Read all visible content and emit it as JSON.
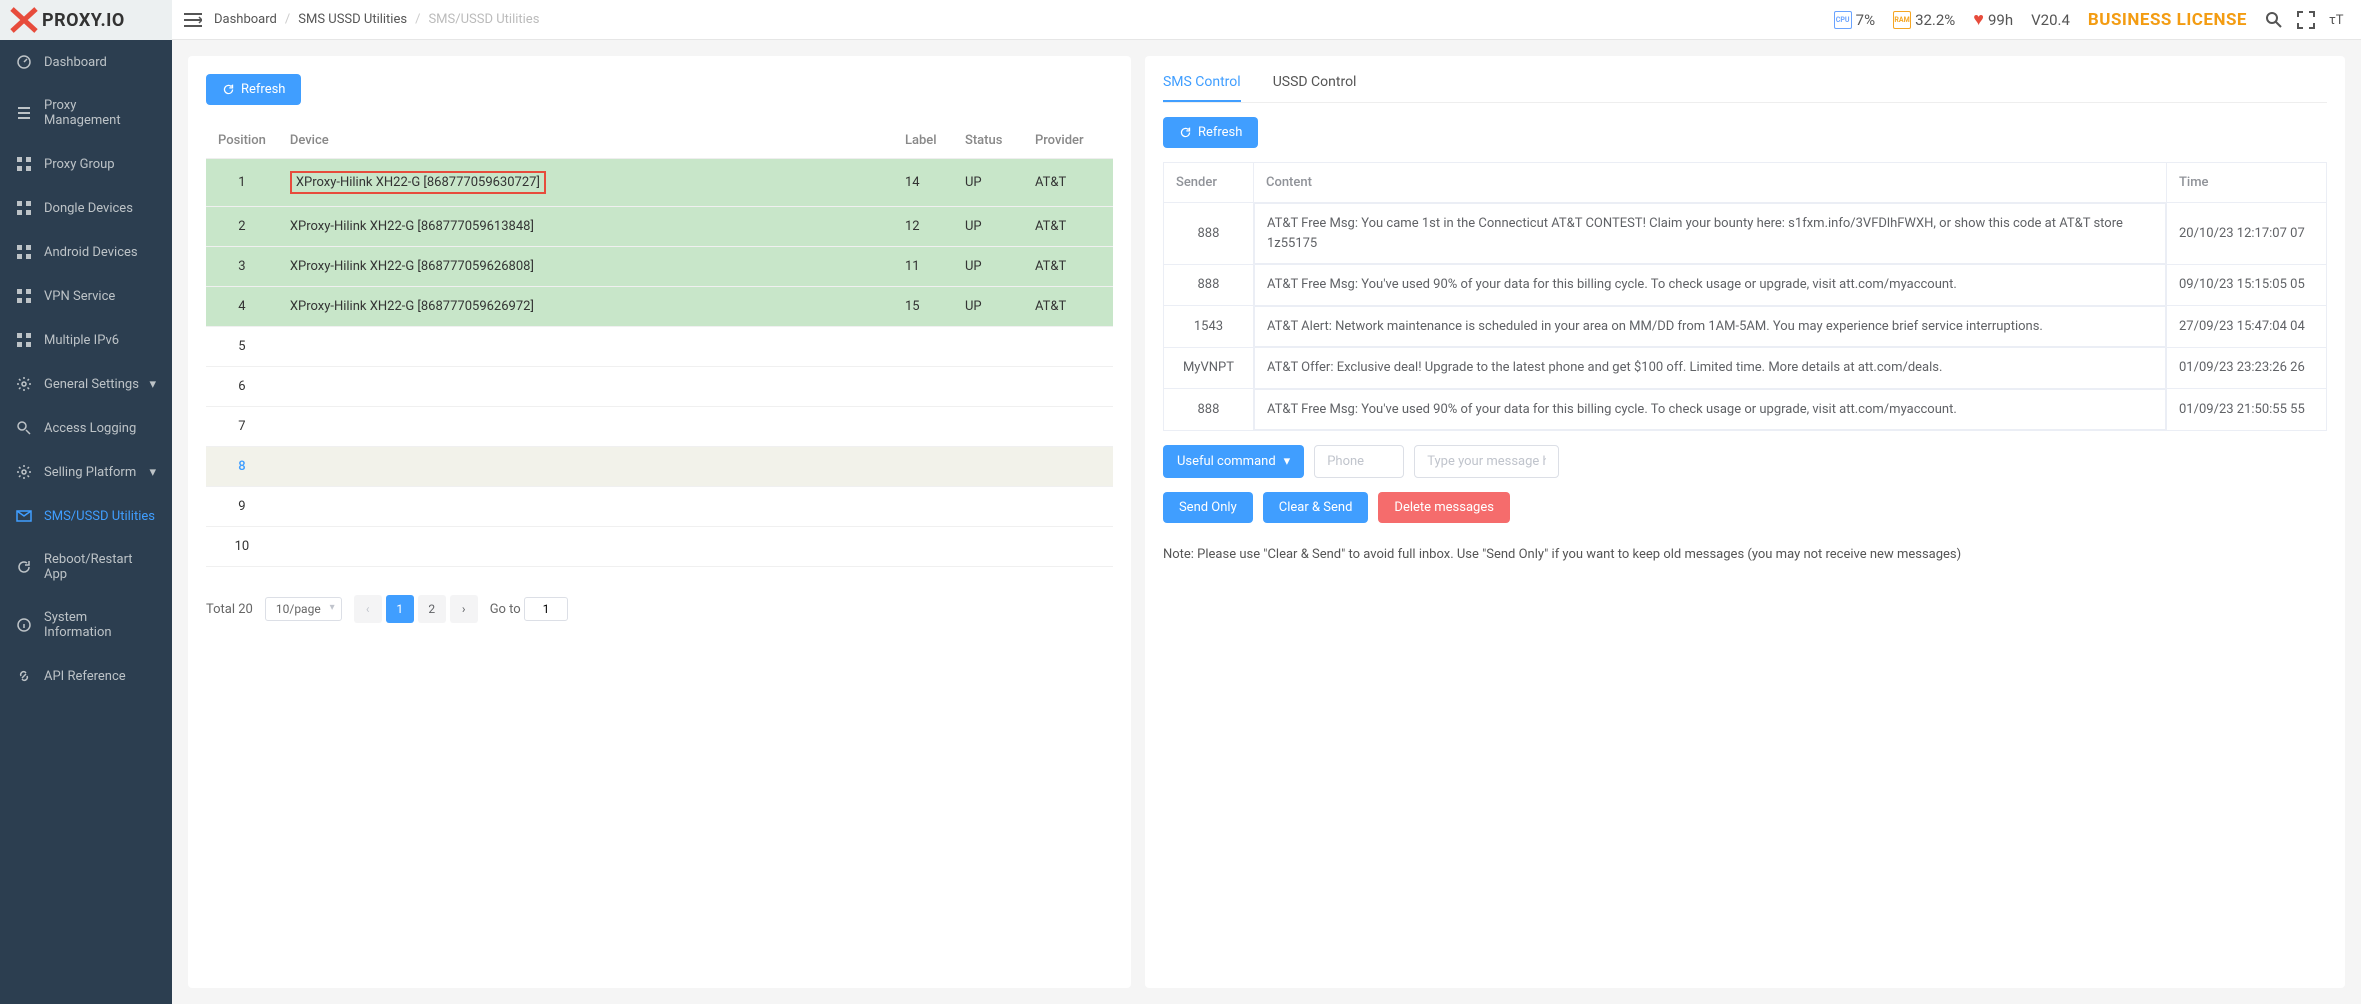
{
  "logo_text": "PROXY.IO",
  "sidebar": {
    "items": [
      {
        "label": "Dashboard",
        "icon": "dashboard"
      },
      {
        "label": "Proxy Management",
        "icon": "list"
      },
      {
        "label": "Proxy Group",
        "icon": "grid"
      },
      {
        "label": "Dongle Devices",
        "icon": "grid"
      },
      {
        "label": "Android Devices",
        "icon": "grid"
      },
      {
        "label": "VPN Service",
        "icon": "grid"
      },
      {
        "label": "Multiple IPv6",
        "icon": "grid"
      },
      {
        "label": "General Settings",
        "icon": "gear",
        "chev": true
      },
      {
        "label": "Access Logging",
        "icon": "search"
      },
      {
        "label": "Selling Platform",
        "icon": "gear",
        "chev": true
      },
      {
        "label": "SMS/USSD Utilities",
        "icon": "mail",
        "active": true
      },
      {
        "label": "Reboot/Restart App",
        "icon": "refresh"
      },
      {
        "label": "System Information",
        "icon": "info"
      },
      {
        "label": "API Reference",
        "icon": "link"
      }
    ]
  },
  "breadcrumb": {
    "c1": "Dashboard",
    "c2": "SMS USSD Utilities",
    "c3": "SMS/USSD Utilities"
  },
  "topbar": {
    "cpu": "7%",
    "ram": "32.2%",
    "health": "99h",
    "version": "V20.4",
    "license": "BUSINESS LICENSE",
    "cpu_label": "CPU",
    "ram_label": "RAM"
  },
  "left_panel": {
    "refresh": "Refresh",
    "headers": {
      "position": "Position",
      "device": "Device",
      "label": "Label",
      "status": "Status",
      "provider": "Provider"
    },
    "rows": [
      {
        "pos": "1",
        "device": "XProxy-Hilink XH22-G [868777059630727]",
        "label": "14",
        "status": "UP",
        "provider": "AT&T",
        "green": true,
        "highlight": true
      },
      {
        "pos": "2",
        "device": "XProxy-Hilink XH22-G [868777059613848]",
        "label": "12",
        "status": "UP",
        "provider": "AT&T",
        "green": true
      },
      {
        "pos": "3",
        "device": "XProxy-Hilink XH22-G [868777059626808]",
        "label": "11",
        "status": "UP",
        "provider": "AT&T",
        "green": true
      },
      {
        "pos": "4",
        "device": "XProxy-Hilink XH22-G [868777059626972]",
        "label": "15",
        "status": "UP",
        "provider": "AT&T",
        "green": true
      },
      {
        "pos": "5"
      },
      {
        "pos": "6"
      },
      {
        "pos": "7"
      },
      {
        "pos": "8",
        "hover": true,
        "active_pos": true
      },
      {
        "pos": "9"
      },
      {
        "pos": "10"
      }
    ],
    "pagination": {
      "total": "Total 20",
      "page_size": "10/page",
      "pages": [
        "1",
        "2"
      ],
      "active_page": "1",
      "goto_label": "Go to",
      "goto_value": "1"
    }
  },
  "right_panel": {
    "tabs": {
      "sms": "SMS Control",
      "ussd": "USSD Control"
    },
    "refresh": "Refresh",
    "headers": {
      "sender": "Sender",
      "content": "Content",
      "time": "Time"
    },
    "rows": [
      {
        "sender": "888",
        "content": "AT&T Free Msg: You came 1st in the Connecticut AT&T CONTEST! Claim your bounty here: s1fxm.info/3VFDlhFWXH, or show this code at AT&T store 1z55175",
        "time": "20/10/23 12:17:07 07"
      },
      {
        "sender": "888",
        "content": "AT&T Free Msg: You've used 90% of your data for this billing cycle. To check usage or upgrade, visit att.com/myaccount.",
        "time": "09/10/23 15:15:05 05"
      },
      {
        "sender": "1543",
        "content": "AT&T Alert: Network maintenance is scheduled in your area on MM/DD from 1AM-5AM. You may experience brief service interruptions.",
        "time": "27/09/23 15:47:04 04"
      },
      {
        "sender": "MyVNPT",
        "content": "AT&T Offer: Exclusive deal! Upgrade to the latest phone and get $100 off. Limited time. More details at att.com/deals.",
        "time": "01/09/23 23:23:26 26"
      },
      {
        "sender": "888",
        "content": "AT&T Free Msg: You've used 90% of your data for this billing cycle. To check usage or upgrade, visit att.com/myaccount.",
        "time": "01/09/23 21:50:55 55"
      }
    ],
    "controls": {
      "useful_command": "Useful command",
      "phone_placeholder": "Phone",
      "msg_placeholder": "Type your message here",
      "send_only": "Send Only",
      "clear_send": "Clear & Send",
      "delete": "Delete messages"
    },
    "note": "Note: Please use \"Clear & Send\" to avoid full inbox. Use \"Send Only\" if you want to keep old messages (you may not receive new messages)"
  }
}
